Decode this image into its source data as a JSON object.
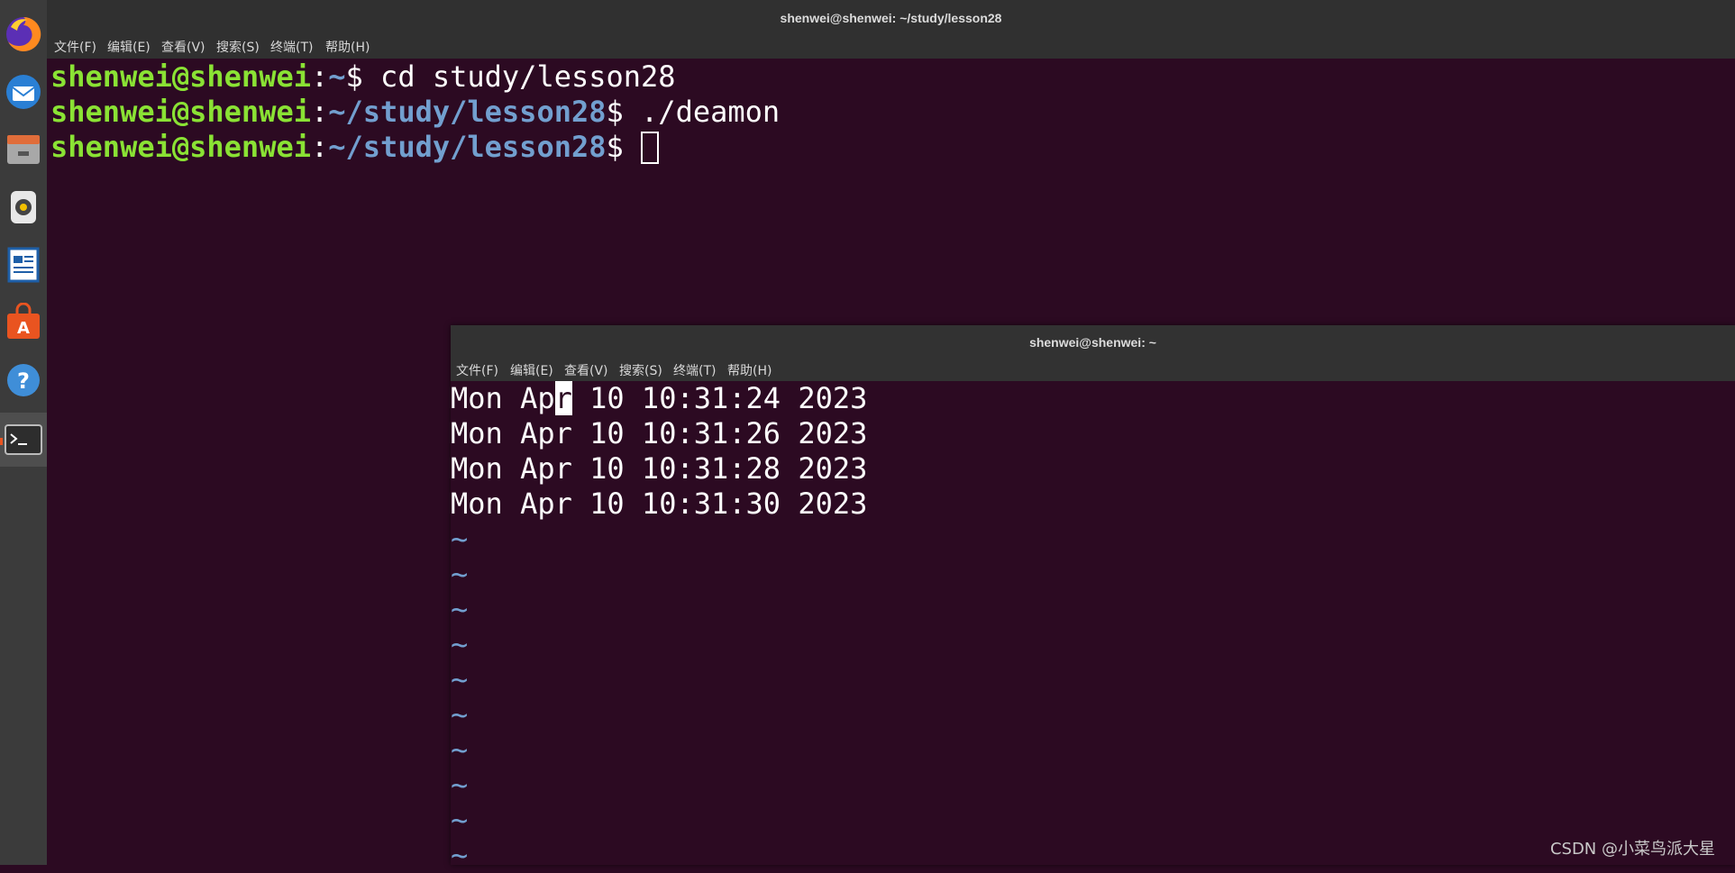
{
  "dock": {
    "items": [
      {
        "name": "firefox-icon"
      },
      {
        "name": "thunderbird-icon"
      },
      {
        "name": "files-icon"
      },
      {
        "name": "rhythmbox-icon"
      },
      {
        "name": "writer-icon"
      },
      {
        "name": "software-center-icon"
      },
      {
        "name": "help-icon"
      },
      {
        "name": "terminal-icon"
      }
    ]
  },
  "main_window": {
    "title": "shenwei@shenwei: ~/study/lesson28",
    "menu": [
      "文件(F)",
      "编辑(E)",
      "查看(V)",
      "搜索(S)",
      "终端(T)",
      "帮助(H)"
    ],
    "lines": [
      {
        "user": "shenwei@shenwei",
        "sep": ":",
        "path": "~",
        "prompt": "$ ",
        "cmd": "cd study/lesson28"
      },
      {
        "user": "shenwei@shenwei",
        "sep": ":",
        "path": "~/study/lesson28",
        "prompt": "$ ",
        "cmd": "./deamon"
      },
      {
        "user": "shenwei@shenwei",
        "sep": ":",
        "path": "~/study/lesson28",
        "prompt": "$ ",
        "cmd": ""
      }
    ]
  },
  "vim_window": {
    "title": "shenwei@shenwei: ~",
    "menu": [
      "文件(F)",
      "编辑(E)",
      "查看(V)",
      "搜索(S)",
      "终端(T)",
      "帮助(H)"
    ],
    "first_line": {
      "before": "Mon Ap",
      "cursor": "r",
      "after": " 10 10:31:24 2023"
    },
    "lines": [
      "Mon Apr 10 10:31:26 2023",
      "Mon Apr 10 10:31:28 2023",
      "Mon Apr 10 10:31:30 2023"
    ],
    "tilde": "~"
  },
  "watermark": "CSDN @小菜鸟派大星"
}
